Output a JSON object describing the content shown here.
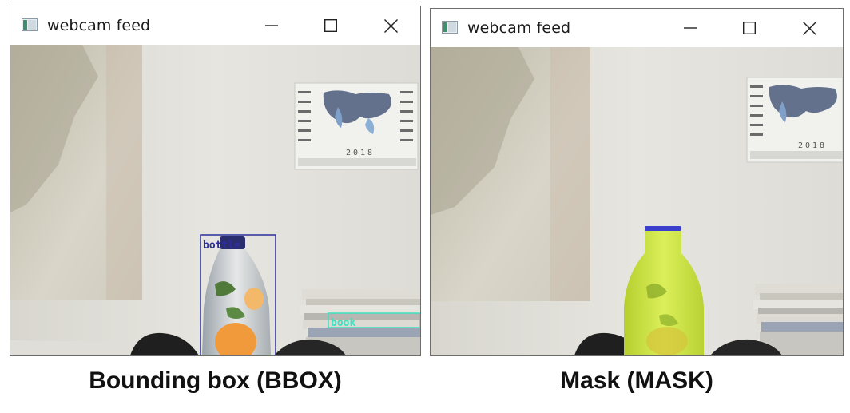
{
  "windows": [
    {
      "title": "webcam feed",
      "controls": {
        "minimize": "minimize-icon",
        "maximize": "maximize-icon",
        "close": "close-icon"
      },
      "detections": [
        {
          "label": "bottle",
          "color": "#2c2f9a"
        },
        {
          "label": "book",
          "color": "#3de0c0"
        }
      ],
      "wall_calendar_year": "2018"
    },
    {
      "title": "webcam feed",
      "controls": {
        "minimize": "minimize-icon",
        "maximize": "maximize-icon",
        "close": "close-icon"
      },
      "mask_color": "#c8e43a",
      "wall_calendar_year": "2018"
    }
  ],
  "captions": {
    "left": "Bounding box (BBOX)",
    "right": "Mask (MASK)"
  }
}
